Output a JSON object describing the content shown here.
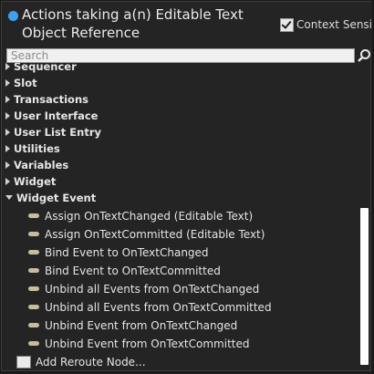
{
  "header": {
    "title": "Actions taking a(n) Editable Text Object Reference",
    "context_label": "Context Sensitive",
    "context_checked": true
  },
  "search": {
    "placeholder": "Search"
  },
  "categories": [
    {
      "label": "Sequencer",
      "expanded": false
    },
    {
      "label": "Slot",
      "expanded": false
    },
    {
      "label": "Transactions",
      "expanded": false
    },
    {
      "label": "User Interface",
      "expanded": false
    },
    {
      "label": "User List Entry",
      "expanded": false
    },
    {
      "label": "Utilities",
      "expanded": false
    },
    {
      "label": "Variables",
      "expanded": false
    },
    {
      "label": "Widget",
      "expanded": false
    },
    {
      "label": "Widget Event",
      "expanded": true
    }
  ],
  "widget_event_items": [
    "Assign OnTextChanged (Editable Text)",
    "Assign OnTextCommitted (Editable Text)",
    "Bind Event to OnTextChanged",
    "Bind Event to OnTextCommitted",
    "Unbind all Events from OnTextChanged",
    "Unbind all Events from OnTextCommitted",
    "Unbind Event from OnTextChanged",
    "Unbind Event from OnTextCommitted"
  ],
  "footer": {
    "reroute_label": "Add Reroute Node..."
  },
  "colors": {
    "accent": "#3ea0f5",
    "background": "#242424"
  }
}
